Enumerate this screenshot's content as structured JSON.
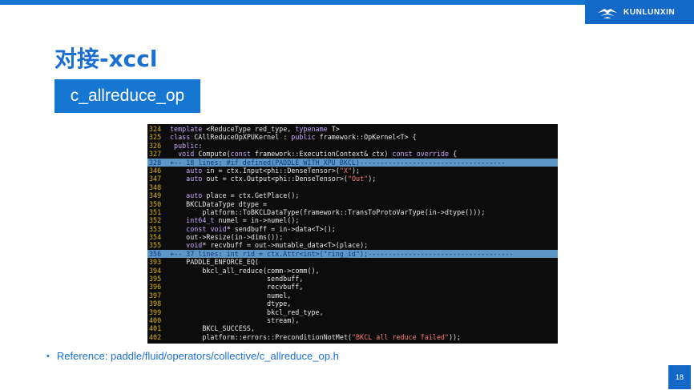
{
  "brand": {
    "logo_icon": "kunlunxin-logo-icon",
    "name": "KUNLUNXIN",
    "color": "#1469c8"
  },
  "title": "对接-xccl",
  "op_box": {
    "label": "c_allreduce_op",
    "color": "#1677d2"
  },
  "code": [
    {
      "num": "324",
      "text": "template <ReduceType red_type, typename T>"
    },
    {
      "num": "325",
      "text": "class CAllReduceOpXPUKernel : public framework::OpKernel<T> {"
    },
    {
      "num": "326",
      "text": " public:"
    },
    {
      "num": "327",
      "text": "  void Compute(const framework::ExecutionContext& ctx) const override {"
    },
    {
      "num": "328",
      "text": "+-- 18 lines: #if defined(PADDLE_WITH_XPU_BKCL)------------------------------------",
      "fold": true
    },
    {
      "num": "346",
      "text": "    auto in = ctx.Input<phi::DenseTensor>(\"X\");"
    },
    {
      "num": "347",
      "text": "    auto out = ctx.Output<phi::DenseTensor>(\"Out\");"
    },
    {
      "num": "348",
      "text": ""
    },
    {
      "num": "349",
      "text": "    auto place = ctx.GetPlace();"
    },
    {
      "num": "350",
      "text": "    BKCLDataType dtype ="
    },
    {
      "num": "351",
      "text": "        platform::ToBKCLDataType(framework::TransToProtoVarType(in->dtype()));"
    },
    {
      "num": "352",
      "text": "    int64_t numel = in->numel();"
    },
    {
      "num": "353",
      "text": "    const void* sendbuff = in->data<T>();"
    },
    {
      "num": "354",
      "text": "    out->Resize(in->dims());"
    },
    {
      "num": "355",
      "text": "    void* recvbuff = out->mutable_data<T>(place);"
    },
    {
      "num": "356",
      "text": "+-- 37 lines: int rid = ctx.Attr<int>(\"ring_id\");------------------------------------",
      "fold": true
    },
    {
      "num": "393",
      "text": "    PADDLE_ENFORCE_EQ("
    },
    {
      "num": "394",
      "text": "        bkcl_all_reduce(comm->comm(),"
    },
    {
      "num": "395",
      "text": "                        sendbuff,"
    },
    {
      "num": "396",
      "text": "                        recvbuff,"
    },
    {
      "num": "397",
      "text": "                        numel,"
    },
    {
      "num": "398",
      "text": "                        dtype,"
    },
    {
      "num": "399",
      "text": "                        bkcl_red_type,"
    },
    {
      "num": "400",
      "text": "                        stream),"
    },
    {
      "num": "401",
      "text": "        BKCL_SUCCESS,"
    },
    {
      "num": "402",
      "text": "        platform::errors::PreconditionNotMet(\"BKCL all reduce failed\"));"
    }
  ],
  "reference": "Reference: paddle/fluid/operators/collective/c_allreduce_op.h",
  "page_number": "18"
}
